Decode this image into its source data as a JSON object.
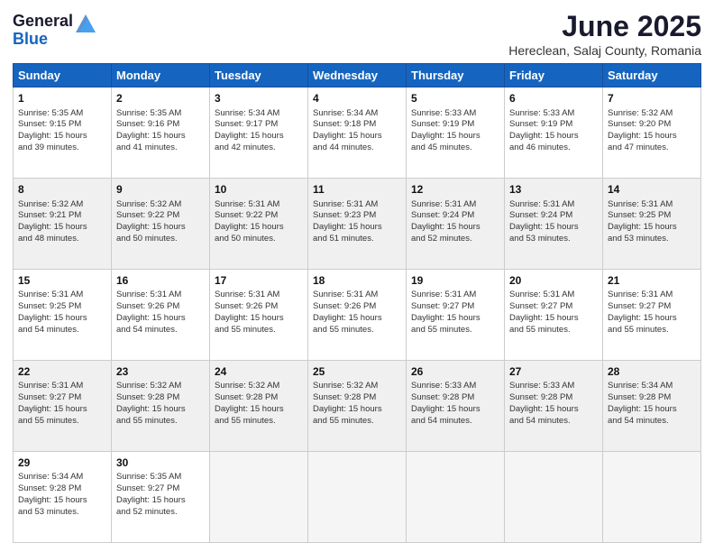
{
  "header": {
    "logo_general": "General",
    "logo_blue": "Blue",
    "title": "June 2025",
    "subtitle": "Hereclean, Salaj County, Romania"
  },
  "calendar": {
    "days_of_week": [
      "Sunday",
      "Monday",
      "Tuesday",
      "Wednesday",
      "Thursday",
      "Friday",
      "Saturday"
    ],
    "weeks": [
      [
        {
          "day": "",
          "empty": true
        },
        {
          "day": "",
          "empty": true
        },
        {
          "day": "",
          "empty": true
        },
        {
          "day": "",
          "empty": true
        },
        {
          "day": "",
          "empty": true
        },
        {
          "day": "",
          "empty": true
        },
        {
          "day": "",
          "empty": true
        }
      ]
    ],
    "cells": [
      [
        {
          "num": "1",
          "lines": [
            "Sunrise: 5:35 AM",
            "Sunset: 9:15 PM",
            "Daylight: 15 hours",
            "and 39 minutes."
          ]
        },
        {
          "num": "2",
          "lines": [
            "Sunrise: 5:35 AM",
            "Sunset: 9:16 PM",
            "Daylight: 15 hours",
            "and 41 minutes."
          ]
        },
        {
          "num": "3",
          "lines": [
            "Sunrise: 5:34 AM",
            "Sunset: 9:17 PM",
            "Daylight: 15 hours",
            "and 42 minutes."
          ]
        },
        {
          "num": "4",
          "lines": [
            "Sunrise: 5:34 AM",
            "Sunset: 9:18 PM",
            "Daylight: 15 hours",
            "and 44 minutes."
          ]
        },
        {
          "num": "5",
          "lines": [
            "Sunrise: 5:33 AM",
            "Sunset: 9:19 PM",
            "Daylight: 15 hours",
            "and 45 minutes."
          ]
        },
        {
          "num": "6",
          "lines": [
            "Sunrise: 5:33 AM",
            "Sunset: 9:19 PM",
            "Daylight: 15 hours",
            "and 46 minutes."
          ]
        },
        {
          "num": "7",
          "lines": [
            "Sunrise: 5:32 AM",
            "Sunset: 9:20 PM",
            "Daylight: 15 hours",
            "and 47 minutes."
          ]
        }
      ],
      [
        {
          "num": "8",
          "lines": [
            "Sunrise: 5:32 AM",
            "Sunset: 9:21 PM",
            "Daylight: 15 hours",
            "and 48 minutes."
          ]
        },
        {
          "num": "9",
          "lines": [
            "Sunrise: 5:32 AM",
            "Sunset: 9:22 PM",
            "Daylight: 15 hours",
            "and 50 minutes."
          ]
        },
        {
          "num": "10",
          "lines": [
            "Sunrise: 5:31 AM",
            "Sunset: 9:22 PM",
            "Daylight: 15 hours",
            "and 50 minutes."
          ]
        },
        {
          "num": "11",
          "lines": [
            "Sunrise: 5:31 AM",
            "Sunset: 9:23 PM",
            "Daylight: 15 hours",
            "and 51 minutes."
          ]
        },
        {
          "num": "12",
          "lines": [
            "Sunrise: 5:31 AM",
            "Sunset: 9:24 PM",
            "Daylight: 15 hours",
            "and 52 minutes."
          ]
        },
        {
          "num": "13",
          "lines": [
            "Sunrise: 5:31 AM",
            "Sunset: 9:24 PM",
            "Daylight: 15 hours",
            "and 53 minutes."
          ]
        },
        {
          "num": "14",
          "lines": [
            "Sunrise: 5:31 AM",
            "Sunset: 9:25 PM",
            "Daylight: 15 hours",
            "and 53 minutes."
          ]
        }
      ],
      [
        {
          "num": "15",
          "lines": [
            "Sunrise: 5:31 AM",
            "Sunset: 9:25 PM",
            "Daylight: 15 hours",
            "and 54 minutes."
          ]
        },
        {
          "num": "16",
          "lines": [
            "Sunrise: 5:31 AM",
            "Sunset: 9:26 PM",
            "Daylight: 15 hours",
            "and 54 minutes."
          ]
        },
        {
          "num": "17",
          "lines": [
            "Sunrise: 5:31 AM",
            "Sunset: 9:26 PM",
            "Daylight: 15 hours",
            "and 55 minutes."
          ]
        },
        {
          "num": "18",
          "lines": [
            "Sunrise: 5:31 AM",
            "Sunset: 9:26 PM",
            "Daylight: 15 hours",
            "and 55 minutes."
          ]
        },
        {
          "num": "19",
          "lines": [
            "Sunrise: 5:31 AM",
            "Sunset: 9:27 PM",
            "Daylight: 15 hours",
            "and 55 minutes."
          ]
        },
        {
          "num": "20",
          "lines": [
            "Sunrise: 5:31 AM",
            "Sunset: 9:27 PM",
            "Daylight: 15 hours",
            "and 55 minutes."
          ]
        },
        {
          "num": "21",
          "lines": [
            "Sunrise: 5:31 AM",
            "Sunset: 9:27 PM",
            "Daylight: 15 hours",
            "and 55 minutes."
          ]
        }
      ],
      [
        {
          "num": "22",
          "lines": [
            "Sunrise: 5:31 AM",
            "Sunset: 9:27 PM",
            "Daylight: 15 hours",
            "and 55 minutes."
          ]
        },
        {
          "num": "23",
          "lines": [
            "Sunrise: 5:32 AM",
            "Sunset: 9:28 PM",
            "Daylight: 15 hours",
            "and 55 minutes."
          ]
        },
        {
          "num": "24",
          "lines": [
            "Sunrise: 5:32 AM",
            "Sunset: 9:28 PM",
            "Daylight: 15 hours",
            "and 55 minutes."
          ]
        },
        {
          "num": "25",
          "lines": [
            "Sunrise: 5:32 AM",
            "Sunset: 9:28 PM",
            "Daylight: 15 hours",
            "and 55 minutes."
          ]
        },
        {
          "num": "26",
          "lines": [
            "Sunrise: 5:33 AM",
            "Sunset: 9:28 PM",
            "Daylight: 15 hours",
            "and 54 minutes."
          ]
        },
        {
          "num": "27",
          "lines": [
            "Sunrise: 5:33 AM",
            "Sunset: 9:28 PM",
            "Daylight: 15 hours",
            "and 54 minutes."
          ]
        },
        {
          "num": "28",
          "lines": [
            "Sunrise: 5:34 AM",
            "Sunset: 9:28 PM",
            "Daylight: 15 hours",
            "and 54 minutes."
          ]
        }
      ],
      [
        {
          "num": "29",
          "lines": [
            "Sunrise: 5:34 AM",
            "Sunset: 9:28 PM",
            "Daylight: 15 hours",
            "and 53 minutes."
          ]
        },
        {
          "num": "30",
          "lines": [
            "Sunrise: 5:35 AM",
            "Sunset: 9:27 PM",
            "Daylight: 15 hours",
            "and 52 minutes."
          ]
        },
        {
          "num": "",
          "empty": true
        },
        {
          "num": "",
          "empty": true
        },
        {
          "num": "",
          "empty": true
        },
        {
          "num": "",
          "empty": true
        },
        {
          "num": "",
          "empty": true
        }
      ]
    ]
  }
}
